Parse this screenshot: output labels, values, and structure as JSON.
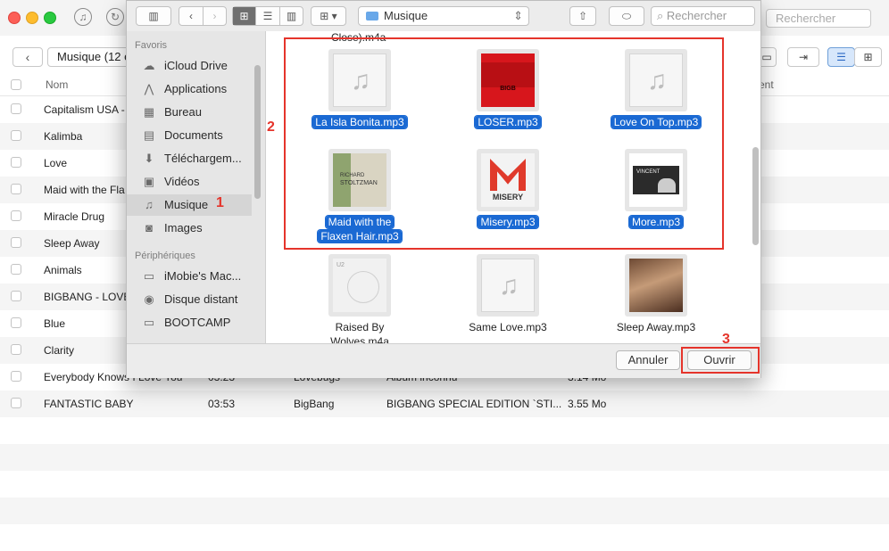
{
  "bg": {
    "search_placeholder": "Rechercher",
    "breadcrumb": "Musique (12 é",
    "back_icon": "‹",
    "col_name": "Nom",
    "col_right": "ent",
    "rows": [
      {
        "name": "Capitalism USA -",
        "time": "",
        "artist": "",
        "album": "",
        "size": ""
      },
      {
        "name": "Kalimba",
        "time": "",
        "artist": "",
        "album": "",
        "size": ""
      },
      {
        "name": "Love",
        "time": "",
        "artist": "",
        "album": "",
        "size": ""
      },
      {
        "name": "Maid with the Fla",
        "time": "",
        "artist": "",
        "album": "",
        "size": ""
      },
      {
        "name": "Miracle Drug",
        "time": "",
        "artist": "",
        "album": "",
        "size": ""
      },
      {
        "name": "Sleep Away",
        "time": "",
        "artist": "",
        "album": "",
        "size": ""
      },
      {
        "name": "Animals",
        "time": "",
        "artist": "",
        "album": "",
        "size": ""
      },
      {
        "name": "BIGBANG - LOVE",
        "time": "",
        "artist": "",
        "album": "",
        "size": ""
      },
      {
        "name": "Blue",
        "time": "",
        "artist": "",
        "album": "",
        "size": ""
      },
      {
        "name": "Clarity",
        "time": "",
        "artist": "",
        "album": "",
        "size": ""
      },
      {
        "name": "Everybody Knows I Love You",
        "time": "03:23",
        "artist": "Lovebugs",
        "album": "Album inconnu",
        "size": "3.14 Mo"
      },
      {
        "name": "FANTASTIC BABY",
        "time": "03:53",
        "artist": "BigBang",
        "album": "BIGBANG SPECIAL EDITION `STI...",
        "size": "3.55 Mo"
      }
    ]
  },
  "dialog": {
    "location": "Musique",
    "search_placeholder": "Rechercher",
    "sidebar": {
      "favorites_title": "Favoris",
      "devices_title": "Périphériques",
      "favorites": [
        {
          "label": "iCloud Drive",
          "icon": "☁"
        },
        {
          "label": "Applications",
          "icon": "⋀"
        },
        {
          "label": "Bureau",
          "icon": "▦"
        },
        {
          "label": "Documents",
          "icon": "▤"
        },
        {
          "label": "Téléchargem...",
          "icon": "⬇"
        },
        {
          "label": "Vidéos",
          "icon": "▣"
        },
        {
          "label": "Musique",
          "icon": "♫"
        },
        {
          "label": "Images",
          "icon": "◙"
        }
      ],
      "devices": [
        {
          "label": "iMobie's Mac...",
          "icon": "▭"
        },
        {
          "label": "Disque distant",
          "icon": "◉"
        },
        {
          "label": "BOOTCAMP",
          "icon": "▭"
        }
      ]
    },
    "top_cut_label": "Close).m4a",
    "files": [
      {
        "line1": "La Isla Bonita.mp3",
        "line2": "",
        "selected": true
      },
      {
        "line1": "LOSER.mp3",
        "line2": "",
        "selected": true
      },
      {
        "line1": "Love On Top.mp3",
        "line2": "",
        "selected": true
      },
      {
        "line1": "Maid with the",
        "line2": "Flaxen Hair.mp3",
        "selected": true
      },
      {
        "line1": "Misery.mp3",
        "line2": "",
        "selected": true
      },
      {
        "line1": "More.mp3",
        "line2": "",
        "selected": true
      },
      {
        "line1": "Raised By",
        "line2": "Wolves.m4a",
        "selected": false
      },
      {
        "line1": "Same Love.mp3",
        "line2": "",
        "selected": false
      },
      {
        "line1": "Sleep Away.mp3",
        "line2": "",
        "selected": false
      }
    ],
    "cover_texts": {
      "richard_1": "RICHARD",
      "richard_2": "STOLTZMAN",
      "misery": "MISERY",
      "vincent": "VINCENT",
      "u2": "U2",
      "loser_logo": "ВIGВ"
    },
    "cancel_label": "Annuler",
    "open_label": "Ouvrir"
  },
  "annotations": {
    "step1": "1",
    "step2": "2",
    "step3": "3",
    "color": "#e5342b"
  }
}
